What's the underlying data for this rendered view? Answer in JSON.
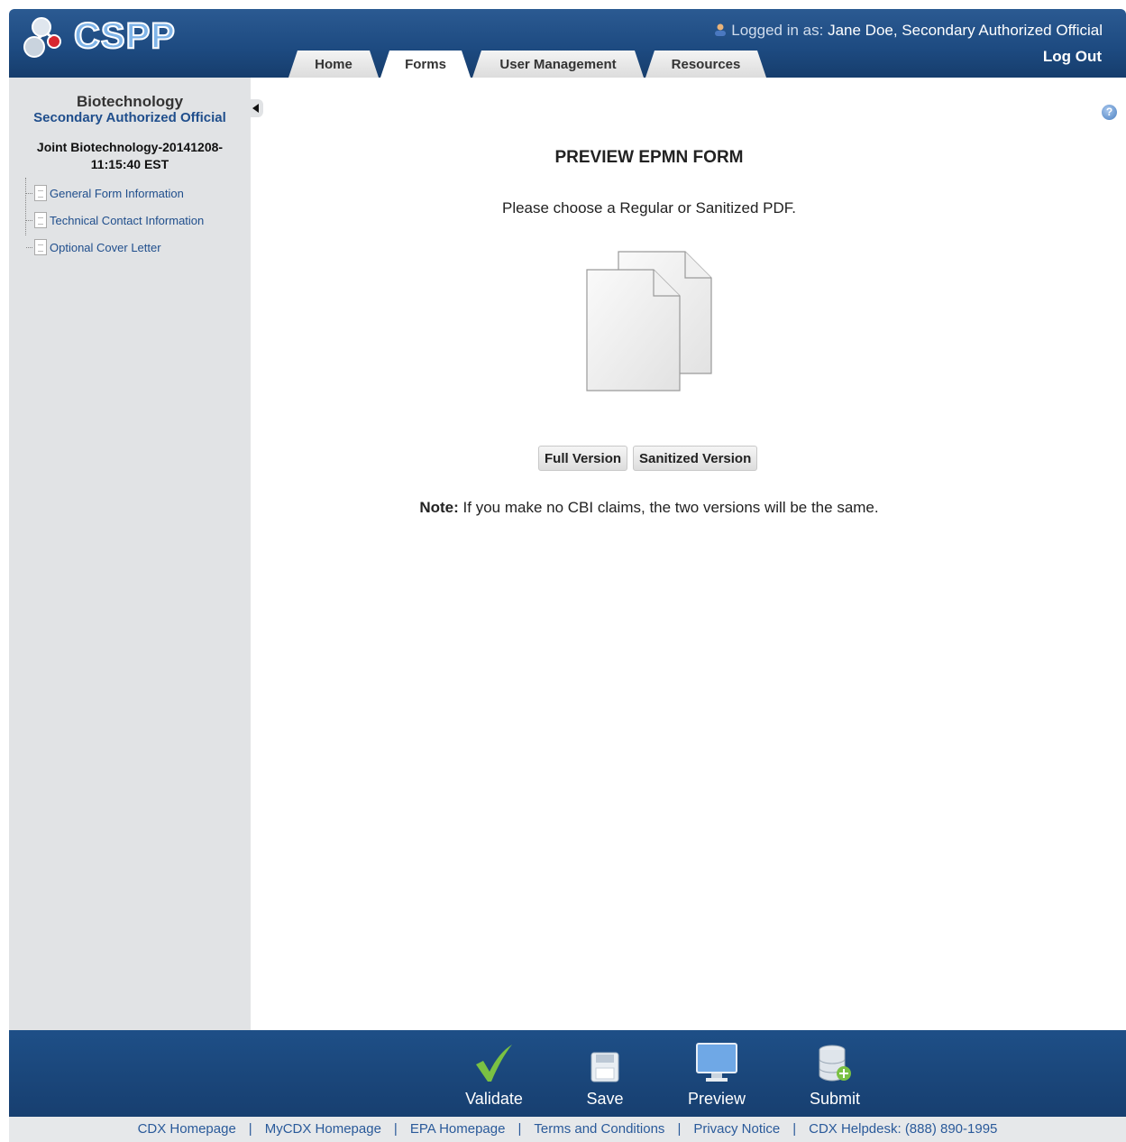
{
  "header": {
    "logo_text": "CSPP",
    "logged_in_label": "Logged in as:",
    "user_name": "Jane Doe, Secondary Authorized Official",
    "logout": "Log Out"
  },
  "tabs": [
    {
      "label": "Home"
    },
    {
      "label": "Forms",
      "active": true
    },
    {
      "label": "User Management"
    },
    {
      "label": "Resources"
    }
  ],
  "sidebar": {
    "title": "Biotechnology",
    "role": "Secondary Authorized Official",
    "form_title_line1": "Joint Biotechnology-20141208-",
    "form_title_line2": "11:15:40 EST",
    "items": [
      {
        "label": "General Form Information"
      },
      {
        "label": "Technical Contact Information"
      },
      {
        "label": "Optional Cover Letter"
      }
    ]
  },
  "main": {
    "title": "PREVIEW EPMN FORM",
    "prompt": "Please choose a Regular or Sanitized PDF.",
    "full_button": "Full Version",
    "sanitized_button": "Sanitized Version",
    "note_label": "Note:",
    "note_text": " If you make no CBI claims, the two versions will be the same."
  },
  "toolbar": {
    "validate": "Validate",
    "save": "Save",
    "preview": "Preview",
    "submit": "Submit"
  },
  "footer": {
    "links": [
      "CDX Homepage",
      "MyCDX Homepage",
      "EPA Homepage",
      "Terms and Conditions",
      "Privacy Notice",
      "CDX Helpdesk: (888) 890-1995"
    ]
  },
  "colors": {
    "header_blue": "#1d4a80",
    "sidebar_gray": "#e1e3e5",
    "link_blue": "#1f4e8c",
    "validate_green": "#7ac143"
  }
}
